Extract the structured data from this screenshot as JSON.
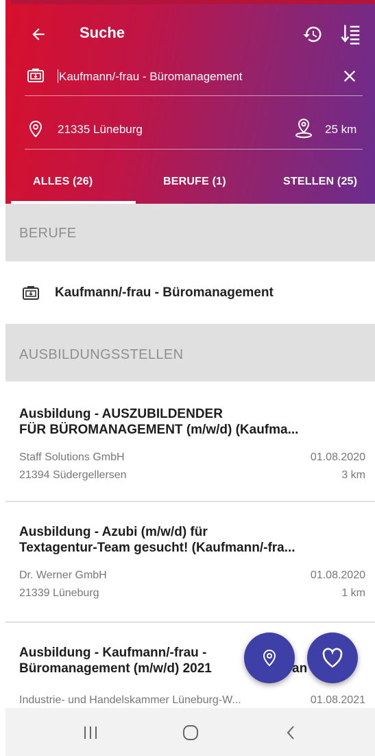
{
  "header": {
    "title": "Suche",
    "search_value": "Kaufmann/-frau - Büromanagement",
    "location_value": "21335 Lüneburg",
    "radius_value": "25 km"
  },
  "tabs": [
    {
      "label": "ALLES (26)",
      "selected": true
    },
    {
      "label": "BERUFE (1)",
      "selected": false
    },
    {
      "label": "STELLEN (25)",
      "selected": false
    }
  ],
  "sections": {
    "berufe_title": "BERUFE",
    "stellen_title": "AUSBILDUNGSSTELLEN"
  },
  "berufe": [
    {
      "label": "Kaufmann/-frau - Büromanagement"
    }
  ],
  "jobs": [
    {
      "title_line1": "Ausbildung - AUSZUBILDENDER",
      "title_line2": "FÜR BÜROMANAGEMENT (m/w/d) (Kaufma...",
      "company": "Staff Solutions GmbH",
      "date": "01.08.2020",
      "location": "21394 Südergellersen",
      "distance": "3 km"
    },
    {
      "title_line1": "Ausbildung - Azubi (m/w/d) für",
      "title_line2": "Textagentur-Team gesucht! (Kaufmann/-fra...",
      "company": "Dr. Werner GmbH",
      "date": "01.08.2020",
      "location": "21339 Lüneburg",
      "distance": "1 km"
    },
    {
      "title_line1": "Ausbildung - Kaufmann/-frau -",
      "title_line2": "Büromanagement (m/w/d) 2021",
      "title_fragment": "an",
      "company": "Industrie- und Handelskammer Lüneburg-W...",
      "date": "01.08.2021"
    }
  ],
  "icons": {
    "back": "arrow-left-icon",
    "history": "history-icon",
    "sort": "sort-list-icon",
    "search_field": "occupation-briefcase-icon",
    "clear": "close-icon",
    "location": "location-pin-icon",
    "radius": "radius-pin-icon",
    "fab_map": "location-pin-icon",
    "fab_favorites": "heart-icon",
    "nav_recents": "recents-icon",
    "nav_home": "home-icon",
    "nav_back": "back-chevron-icon"
  },
  "colors": {
    "header_start": "#d7102c",
    "header_end": "#6a2d8e",
    "fab": "#3f3fa8",
    "section_bg": "#e0e0e0",
    "section_text": "#8f8f8f"
  }
}
